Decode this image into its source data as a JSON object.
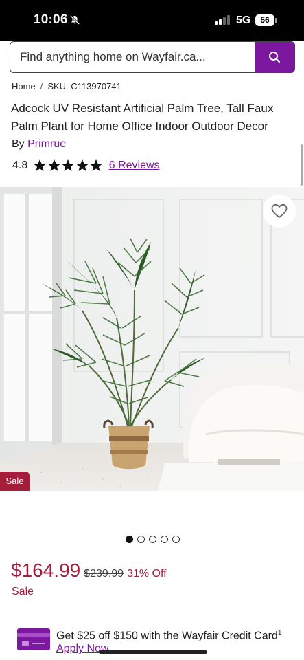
{
  "status_bar": {
    "time": "10:06",
    "network": "5G",
    "battery": "56",
    "icons": [
      "bell-muted-icon",
      "signal-icon"
    ]
  },
  "search": {
    "placeholder": "Find anything home on Wayfair.ca...",
    "button_icon": "search-icon"
  },
  "breadcrumb": {
    "home": "Home",
    "separator": "/",
    "sku": "SKU: C113970741"
  },
  "product": {
    "title": "Adcock UV Resistant Artificial Palm Tree, Tall Faux Palm Plant for Home Office Indoor Outdoor Decor",
    "by_label": "By",
    "brand": "Primrue",
    "rating": "4.8",
    "star_count": 5,
    "reviews_label": "6 Reviews",
    "image_badge": "Sale",
    "image_count": 5,
    "active_image_index": 0
  },
  "pricing": {
    "current": "$164.99",
    "original": "$239.99",
    "discount": "31% Off",
    "sale_label": "Sale"
  },
  "promo": {
    "text": "Get $25 off $150 with the Wayfair Credit Card",
    "footnote": "1",
    "link": "Apply Now"
  },
  "colors": {
    "accent": "#7b189f",
    "sale": "#a41e3c",
    "status_bar": "#000000"
  }
}
